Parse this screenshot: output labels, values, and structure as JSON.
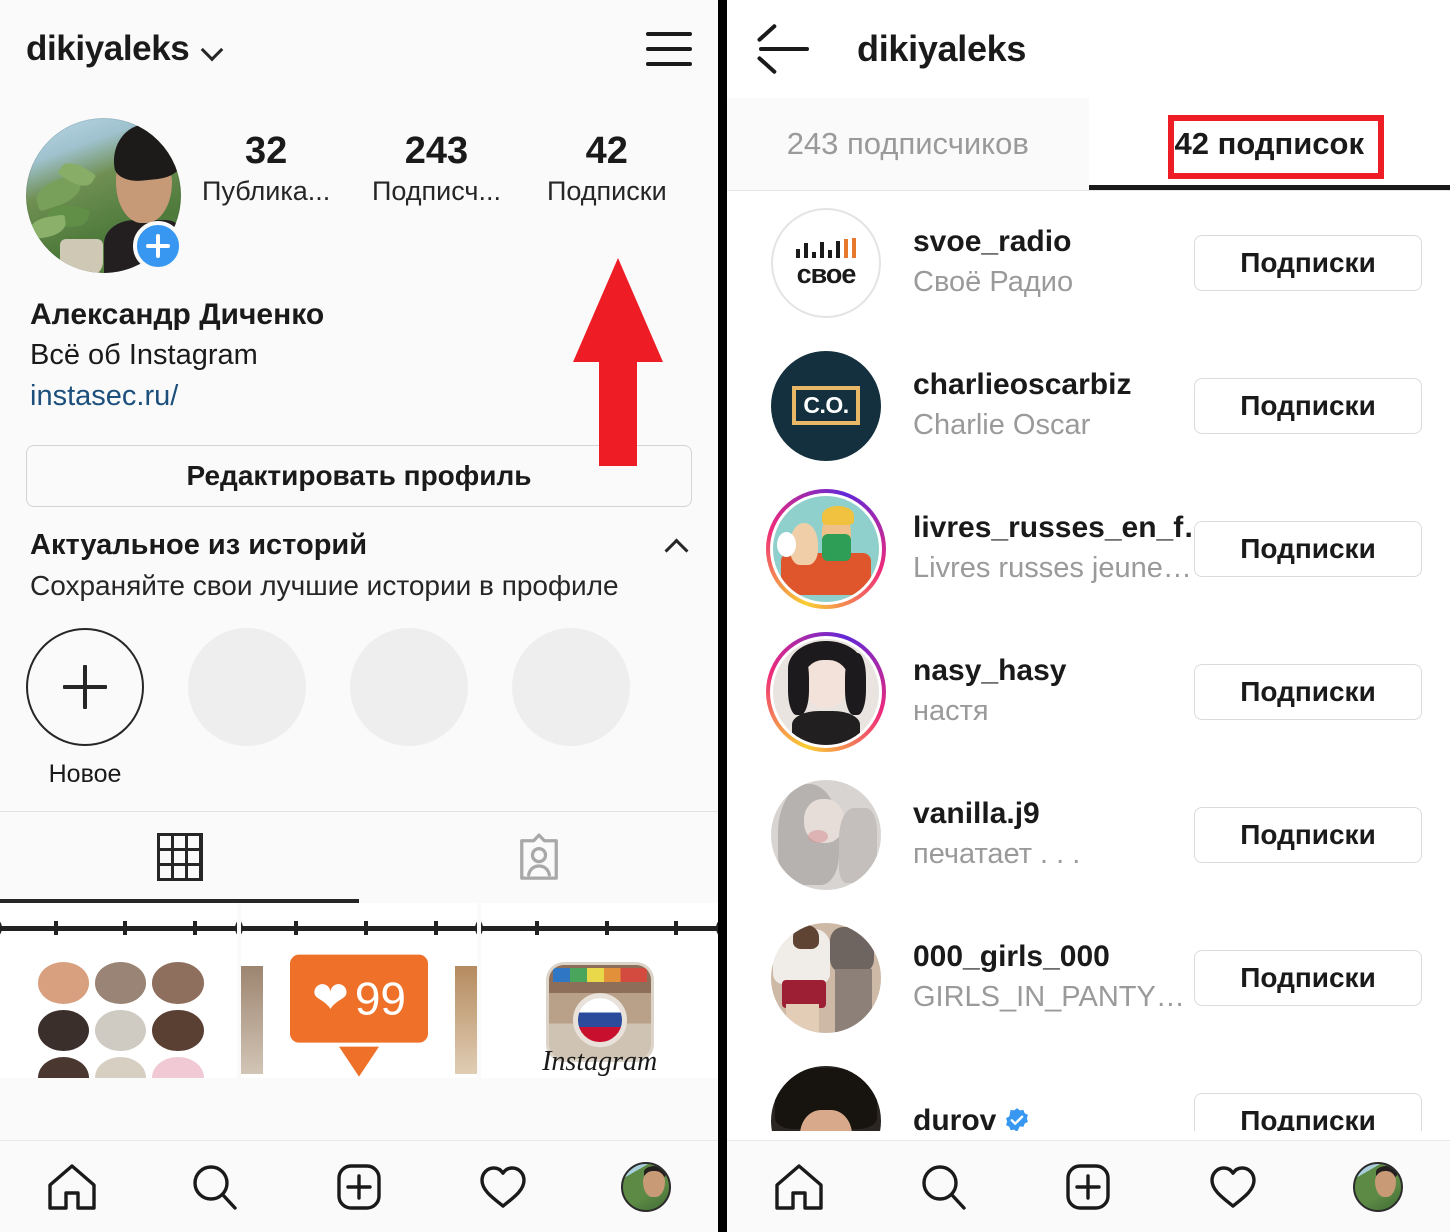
{
  "left": {
    "topbar": {
      "username": "dikiyaleks",
      "chevron_icon": "chevron-down-icon",
      "menu_icon": "hamburger-menu-icon"
    },
    "stats": [
      {
        "num": "32",
        "label": "Публика..."
      },
      {
        "num": "243",
        "label": "Подписч..."
      },
      {
        "num": "42",
        "label": "Подписки"
      }
    ],
    "bio": {
      "name": "Александр Диченко",
      "description": "Всё об Instagram",
      "link": "instasec.ru/"
    },
    "edit_button": "Редактировать профиль",
    "highlights": {
      "title": "Актуальное из историй",
      "subtitle": "Сохраняйте свои лучшие истории в профиле",
      "collapse_icon": "chevron-up-icon",
      "new_label": "Новое"
    },
    "tabs": [
      {
        "icon": "grid-icon",
        "active": true
      },
      {
        "icon": "tagged-person-icon",
        "active": false
      }
    ],
    "post_grid": {
      "post2_badge": "99",
      "post3_caption": "Instagram"
    },
    "annotation": {
      "arrow_color": "#ee1c25",
      "arrow_icon": "red-up-arrow"
    }
  },
  "right": {
    "header": {
      "back_icon": "back-arrow-icon",
      "title": "dikiyaleks"
    },
    "tabs": [
      {
        "label": "243 подписчиков",
        "active": false
      },
      {
        "label": "42 подписок",
        "active": true
      }
    ],
    "highlight_box_color": "#ee1c25",
    "list": [
      {
        "username": "svoe_radio",
        "fullname": "Своё Радио",
        "button": "Подписки",
        "avatar": "svoe-radio-logo",
        "ring": false,
        "verified": false
      },
      {
        "username": "charlieoscarbiz",
        "fullname": "Charlie Oscar",
        "button": "Подписки",
        "avatar": "charlie-oscar-logo",
        "ring": false,
        "verified": false
      },
      {
        "username": "livres_russes_en_f…",
        "fullname": "Livres russes jeune…",
        "button": "Подписки",
        "avatar": "livres-illustration",
        "ring": true,
        "verified": false
      },
      {
        "username": "nasy_hasy",
        "fullname": "настя",
        "button": "Подписки",
        "avatar": "anime-girl-portrait",
        "ring": true,
        "verified": false
      },
      {
        "username": "vanilla.j9",
        "fullname": "печатает . . .",
        "button": "Подписки",
        "avatar": "grey-girl-sketch",
        "ring": false,
        "verified": false
      },
      {
        "username": "000_girls_000",
        "fullname": "GIRLS_IN_PANTY…",
        "button": "Подписки",
        "avatar": "two-girls-photo",
        "ring": false,
        "verified": false
      },
      {
        "username": "durov",
        "fullname": "",
        "button": "Подписки",
        "avatar": "durov-photo",
        "ring": false,
        "verified": true
      }
    ]
  },
  "bottom_nav": [
    {
      "icon": "home-icon",
      "name": "home"
    },
    {
      "icon": "search-icon",
      "name": "search"
    },
    {
      "icon": "add-post-icon",
      "name": "add-post"
    },
    {
      "icon": "heart-icon",
      "name": "activity"
    },
    {
      "icon": "profile-avatar-icon",
      "name": "profile"
    }
  ]
}
